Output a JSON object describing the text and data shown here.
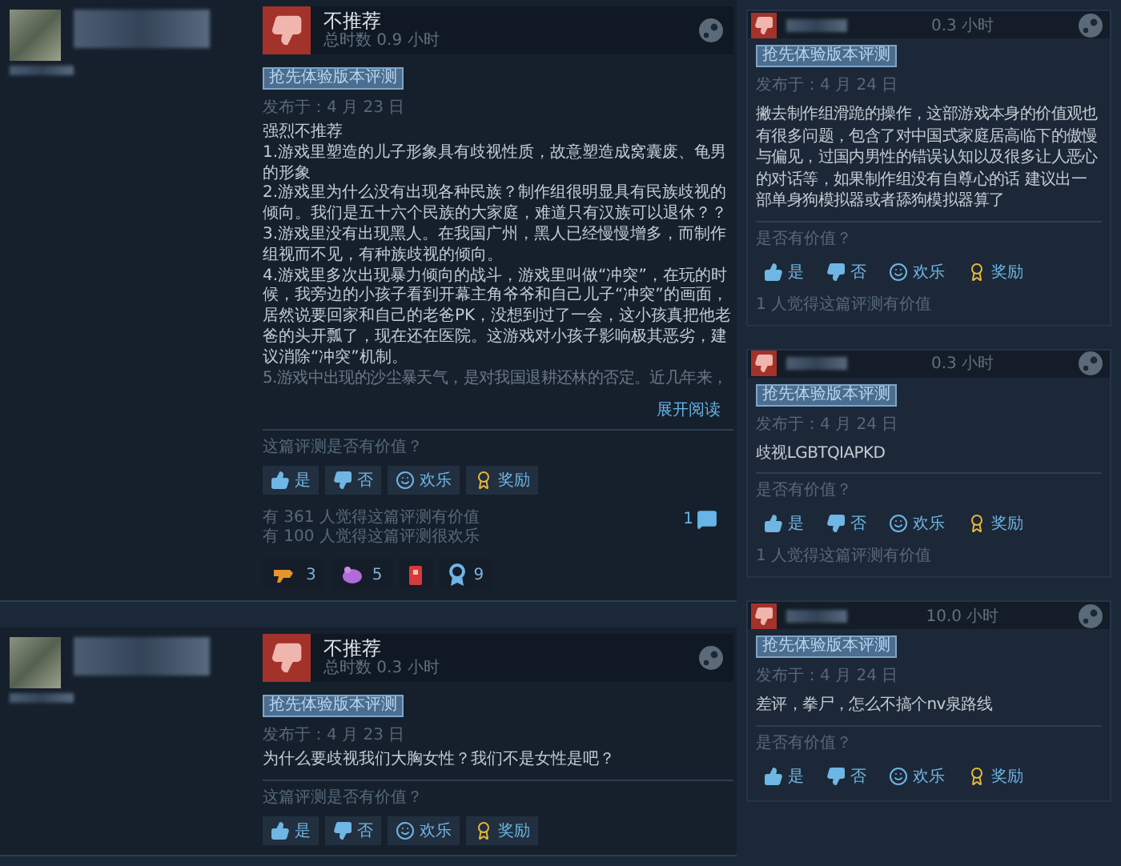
{
  "reviews": [
    {
      "verdict": "不推荐",
      "playtime": "总时数 0.9 小时",
      "badge": "抢先体验版本评测",
      "posted": "发布于：4 月 23 日",
      "paragraphs": [
        "强烈不推荐",
        "1.游戏里塑造的儿子形象具有歧视性质，故意塑造成窝囊废、龟男的形象",
        "2.游戏里为什么没有出现各种民族？制作组很明显具有民族歧视的倾向。我们是五十六个民族的大家庭，难道只有汉族可以退休？？",
        "3.游戏里没有出现黑人。在我国广州，黑人已经慢慢增多，而制作组视而不见，有种族歧视的倾向。",
        "4.游戏里多次出现暴力倾向的战斗，游戏里叫做“冲突”，在玩的时候，我旁边的小孩子看到开幕主角爷爷和自己儿子“冲突”的画面，居然说要回家和自己的老爸PK，没想到过了一会，这小孩真把他老爸的头开瓢了，现在还在医院。这游戏对小孩子影响极其恶劣，建议消除“冲突”机制。"
      ],
      "faded_line": "5.游戏中出现的沙尘暴天气，是对我国退耕还林的否定。近几年来，",
      "expand_link": "展开阅读",
      "helpful_prompt": "这篇评测是否有价值？",
      "vote_buttons": [
        {
          "kind": "yes",
          "label": "是"
        },
        {
          "kind": "no",
          "label": "否"
        },
        {
          "kind": "funny",
          "label": "欢乐"
        },
        {
          "kind": "award",
          "label": "奖励"
        }
      ],
      "stats": [
        "有 361 人觉得这篇评测有价值",
        "有 100 人觉得这篇评测很欢乐"
      ],
      "comment_count": "1",
      "awards": [
        {
          "kind": "hand",
          "count": "3"
        },
        {
          "kind": "blob",
          "count": "5"
        },
        {
          "kind": "card"
        },
        {
          "kind": "medal",
          "count": "9"
        }
      ]
    },
    {
      "verdict": "不推荐",
      "playtime": "总时数 0.3 小时",
      "badge": "抢先体验版本评测",
      "posted": "发布于：4 月 23 日",
      "paragraphs": [
        "为什么要歧视我们大胸女性？我们不是女性是吧？"
      ],
      "helpful_prompt": "这篇评测是否有价值？",
      "vote_buttons": [
        {
          "kind": "yes",
          "label": "是"
        },
        {
          "kind": "no",
          "label": "否"
        },
        {
          "kind": "funny",
          "label": "欢乐"
        },
        {
          "kind": "award",
          "label": "奖励"
        }
      ]
    }
  ],
  "side_reviews": [
    {
      "playtime": "0.3 小时",
      "badge": "抢先体验版本评测",
      "posted": "发布于：4 月 24 日",
      "body": "撇去制作组滑跪的操作，这部游戏本身的价值观也有很多问题，包含了对中国式家庭居高临下的傲慢与偏见，过国内男性的错误认知以及很多让人恶心的对话等，如果制作组没有自尊心的话 建议出一部单身狗模拟器或者舔狗模拟器算了",
      "helpful_prompt": "是否有价值？",
      "vote_buttons": [
        {
          "kind": "yes",
          "label": "是"
        },
        {
          "kind": "no",
          "label": "否"
        },
        {
          "kind": "funny",
          "label": "欢乐"
        },
        {
          "kind": "award",
          "label": "奖励"
        }
      ],
      "stats": "1 人觉得这篇评测有价值"
    },
    {
      "playtime": "0.3 小时",
      "badge": "抢先体验版本评测",
      "posted": "发布于：4 月 24 日",
      "body": "歧视LGBTQIAPKD",
      "helpful_prompt": "是否有价值？",
      "vote_buttons": [
        {
          "kind": "yes",
          "label": "是"
        },
        {
          "kind": "no",
          "label": "否"
        },
        {
          "kind": "funny",
          "label": "欢乐"
        },
        {
          "kind": "award",
          "label": "奖励"
        }
      ],
      "stats": "1 人觉得这篇评测有价值"
    },
    {
      "playtime": "10.0 小时",
      "badge": "抢先体验版本评测",
      "posted": "发布于：4 月 24 日",
      "body": "差评，拳尸，怎么不搞个nv泉路线",
      "helpful_prompt": "是否有价值？",
      "vote_buttons": [
        {
          "kind": "yes",
          "label": "是"
        },
        {
          "kind": "no",
          "label": "否"
        },
        {
          "kind": "funny",
          "label": "欢乐"
        },
        {
          "kind": "award",
          "label": "奖励"
        }
      ]
    }
  ]
}
